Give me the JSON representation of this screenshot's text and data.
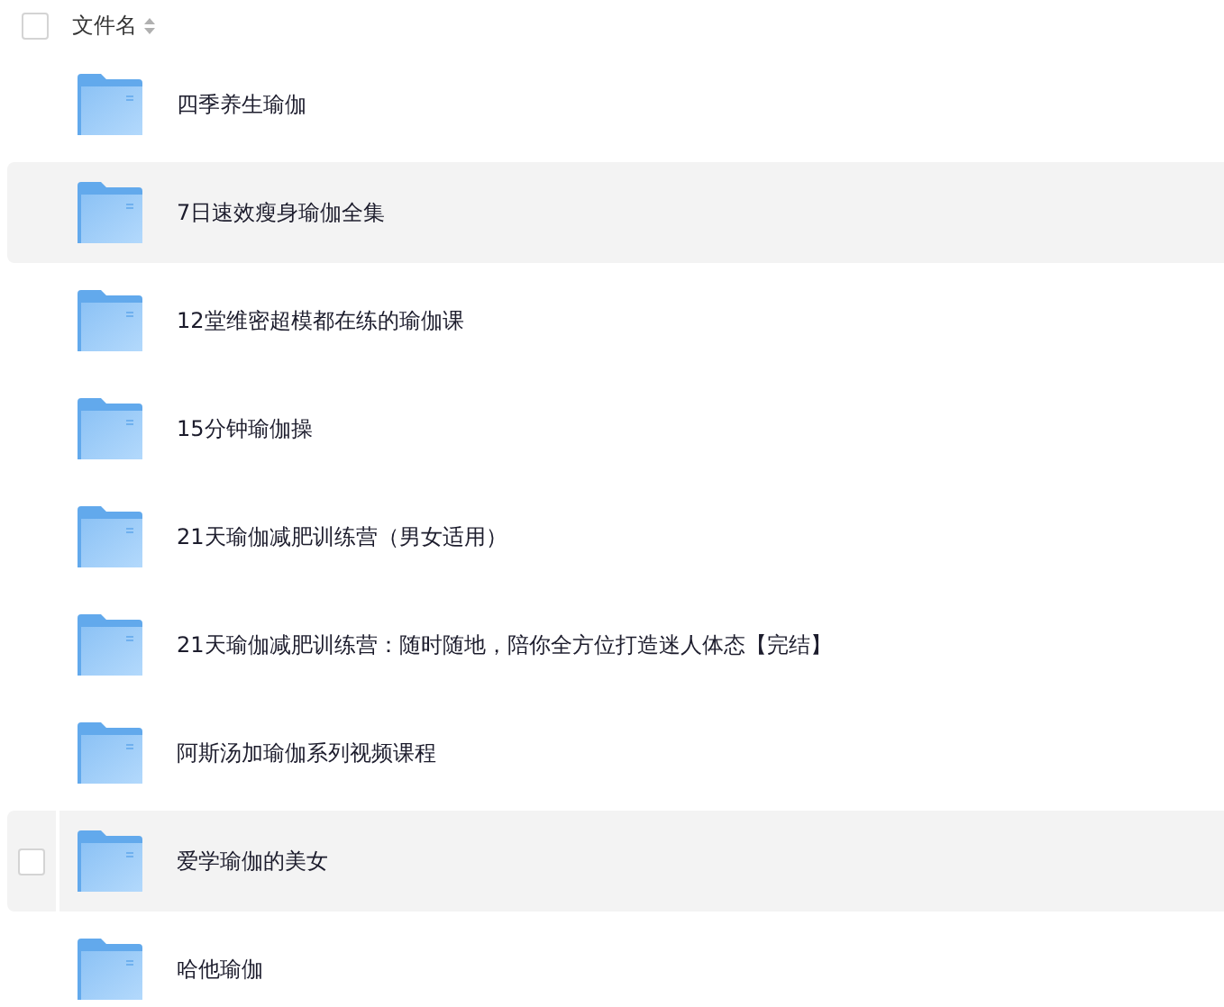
{
  "header": {
    "checked": false,
    "column": "文件名"
  },
  "rows": [
    {
      "name": "四季养生瑜伽",
      "highlighted": false,
      "hovered": false
    },
    {
      "name": "7日速效瘦身瑜伽全集",
      "highlighted": true,
      "hovered": false
    },
    {
      "name": "12堂维密超模都在练的瑜伽课",
      "highlighted": false,
      "hovered": false
    },
    {
      "name": "15分钟瑜伽操",
      "highlighted": false,
      "hovered": false
    },
    {
      "name": "21天瑜伽减肥训练营（男女适用）",
      "highlighted": false,
      "hovered": false
    },
    {
      "name": "21天瑜伽减肥训练营：随时随地，陪你全方位打造迷人体态【完结】",
      "highlighted": false,
      "hovered": false
    },
    {
      "name": "阿斯汤加瑜伽系列视频课程",
      "highlighted": false,
      "hovered": false
    },
    {
      "name": "爱学瑜伽的美女",
      "highlighted": true,
      "hovered": true
    },
    {
      "name": "哈他瑜伽",
      "highlighted": false,
      "hovered": false
    }
  ]
}
